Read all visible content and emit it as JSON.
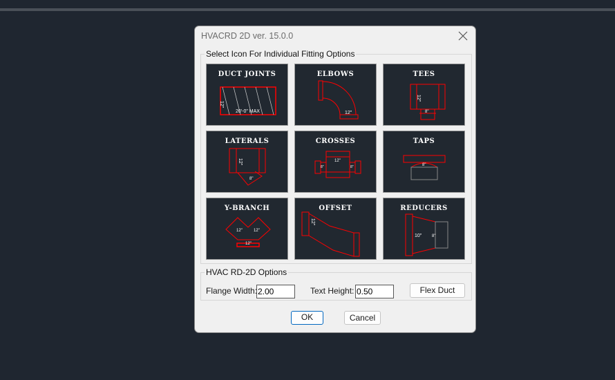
{
  "dialog": {
    "title": "HVACRD 2D ver. 15.0.0"
  },
  "fittings": {
    "legend": "Select Icon For Individual Fitting Options",
    "tiles": [
      {
        "label": "DUCT  JOINTS",
        "dims": [
          "12\"",
          "20'-0\" MAX"
        ]
      },
      {
        "label": "ELBOWS",
        "dims": [
          "12\""
        ]
      },
      {
        "label": "TEES",
        "dims": [
          "12\"",
          "8\""
        ]
      },
      {
        "label": "LATERALS",
        "dims": [
          "12\"",
          "8\""
        ]
      },
      {
        "label": "CROSSES",
        "dims": [
          "12\"",
          "8\"",
          "8\""
        ]
      },
      {
        "label": "TAPS",
        "dims": [
          "8\""
        ]
      },
      {
        "label": "Y-BRANCH",
        "dims": [
          "12\"",
          "12\"",
          "12\""
        ]
      },
      {
        "label": "OFFSET",
        "dims": [
          "12\""
        ]
      },
      {
        "label": "REDUCERS",
        "dims": [
          "10\"",
          "8\""
        ]
      }
    ]
  },
  "options": {
    "legend": "HVAC RD-2D Options",
    "flange_label": "Flange Width:",
    "flange_value": "2.00",
    "text_height_label": "Text Height:",
    "text_height_value": "0.50",
    "flex_duct": "Flex Duct"
  },
  "buttons": {
    "ok": "OK",
    "cancel": "Cancel"
  },
  "colors": {
    "duct": "#ff0000",
    "tile_bg": "#212830",
    "accent": "#0067c0"
  }
}
